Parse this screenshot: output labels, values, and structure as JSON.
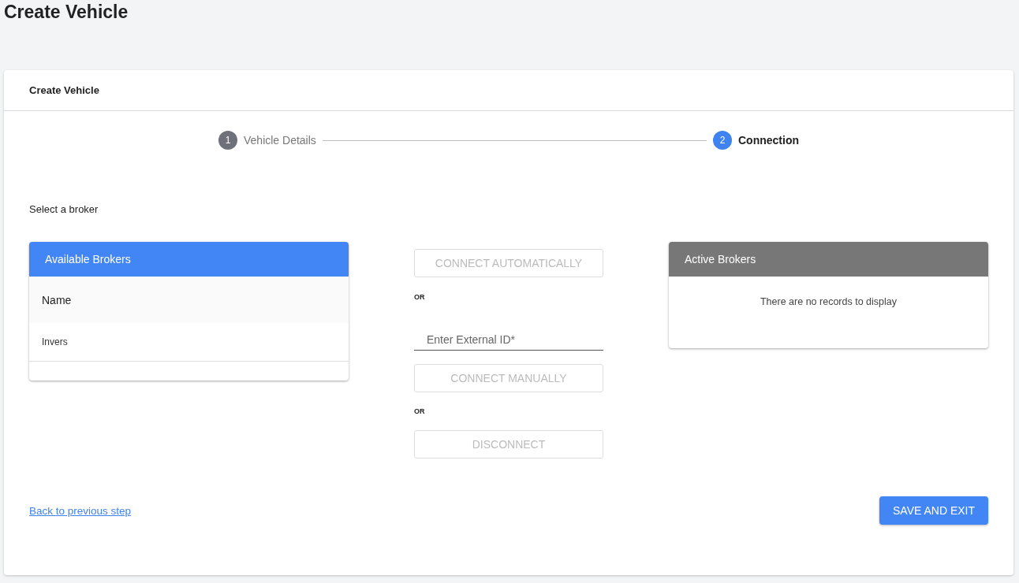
{
  "page_title": "Create Vehicle",
  "card": {
    "title": "Create Vehicle",
    "steps": [
      {
        "number": "1",
        "label": "Vehicle Details",
        "selected": false
      },
      {
        "number": "2",
        "label": "Connection",
        "selected": true
      }
    ],
    "section_label": "Select a broker",
    "available_brokers": {
      "title": "Available Brokers",
      "columns": [
        "Name"
      ],
      "rows": [
        [
          "Invers"
        ]
      ]
    },
    "actions": {
      "connect_automatically": {
        "label": "CONNECT AUTOMATICALLY",
        "disabled": true
      },
      "or_1": "OR",
      "external_id": {
        "placeholder": "Enter External ID*"
      },
      "connect_manually": {
        "label": "CONNECT MANUALLY",
        "disabled": true
      },
      "or_2": "OR",
      "disconnect": {
        "label": "DISCONNECT",
        "disabled": true
      }
    },
    "active_brokers": {
      "title": "Active Brokers",
      "empty_message": "There are no records to display"
    },
    "back_link": "Back to previous step",
    "save_button": "SAVE AND EXIT"
  }
}
